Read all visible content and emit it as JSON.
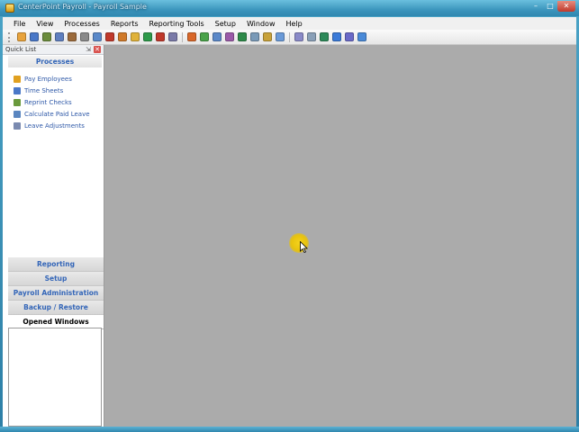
{
  "window": {
    "title": "CenterPoint Payroll - Payroll Sample",
    "controls": {
      "minimize": "–",
      "maximize": "□",
      "close": "✕"
    }
  },
  "menu": [
    "File",
    "View",
    "Processes",
    "Reports",
    "Reporting Tools",
    "Setup",
    "Window",
    "Help"
  ],
  "toolbar": {
    "button_colors": [
      "#e8a33c",
      "#4a78c8",
      "#6b8c3c",
      "#5f7fbf",
      "#9c6b3c",
      "#8a8a8a",
      "#5a89c9",
      "#c0392b",
      "#d07a2a",
      "#e0b23a",
      "#2e9a4a",
      "#c0392b",
      "#7a7aa8",
      "#d9682a",
      "#4aa34a",
      "#5b88c8",
      "#9a5aa8",
      "#2e8a4a",
      "#7a9ab8",
      "#c8a23a",
      "#6a9ad8",
      "#8a8ac8",
      "#8aa0b8",
      "#2e8a5a",
      "#3a7ad8",
      "#6a6ac8",
      "#4a8ad8"
    ]
  },
  "quick_list": {
    "title": "Quick List",
    "pin_icon": "⇲",
    "close_icon": "✕",
    "processes": {
      "header": "Processes",
      "items": [
        {
          "label": "Pay Employees",
          "icon": "people-icon",
          "color": "#e0a020"
        },
        {
          "label": "Time Sheets",
          "icon": "timesheet-icon",
          "color": "#4a78c8"
        },
        {
          "label": "Reprint Checks",
          "icon": "check-icon",
          "color": "#6a9a3c"
        },
        {
          "label": "Calculate Paid Leave",
          "icon": "calculator-icon",
          "color": "#5a86c0"
        },
        {
          "label": "Leave Adjustments",
          "icon": "adjust-icon",
          "color": "#7a8ab0"
        }
      ]
    },
    "sections": [
      {
        "label": "Reporting"
      },
      {
        "label": "Setup"
      },
      {
        "label": "Payroll Administration"
      },
      {
        "label": "Backup / Restore"
      },
      {
        "label": "Opened Windows",
        "active": true
      }
    ]
  },
  "colors": {
    "link": "#2f59a8",
    "client_bg": "#ababab",
    "title_bar": "#3c96bd"
  }
}
